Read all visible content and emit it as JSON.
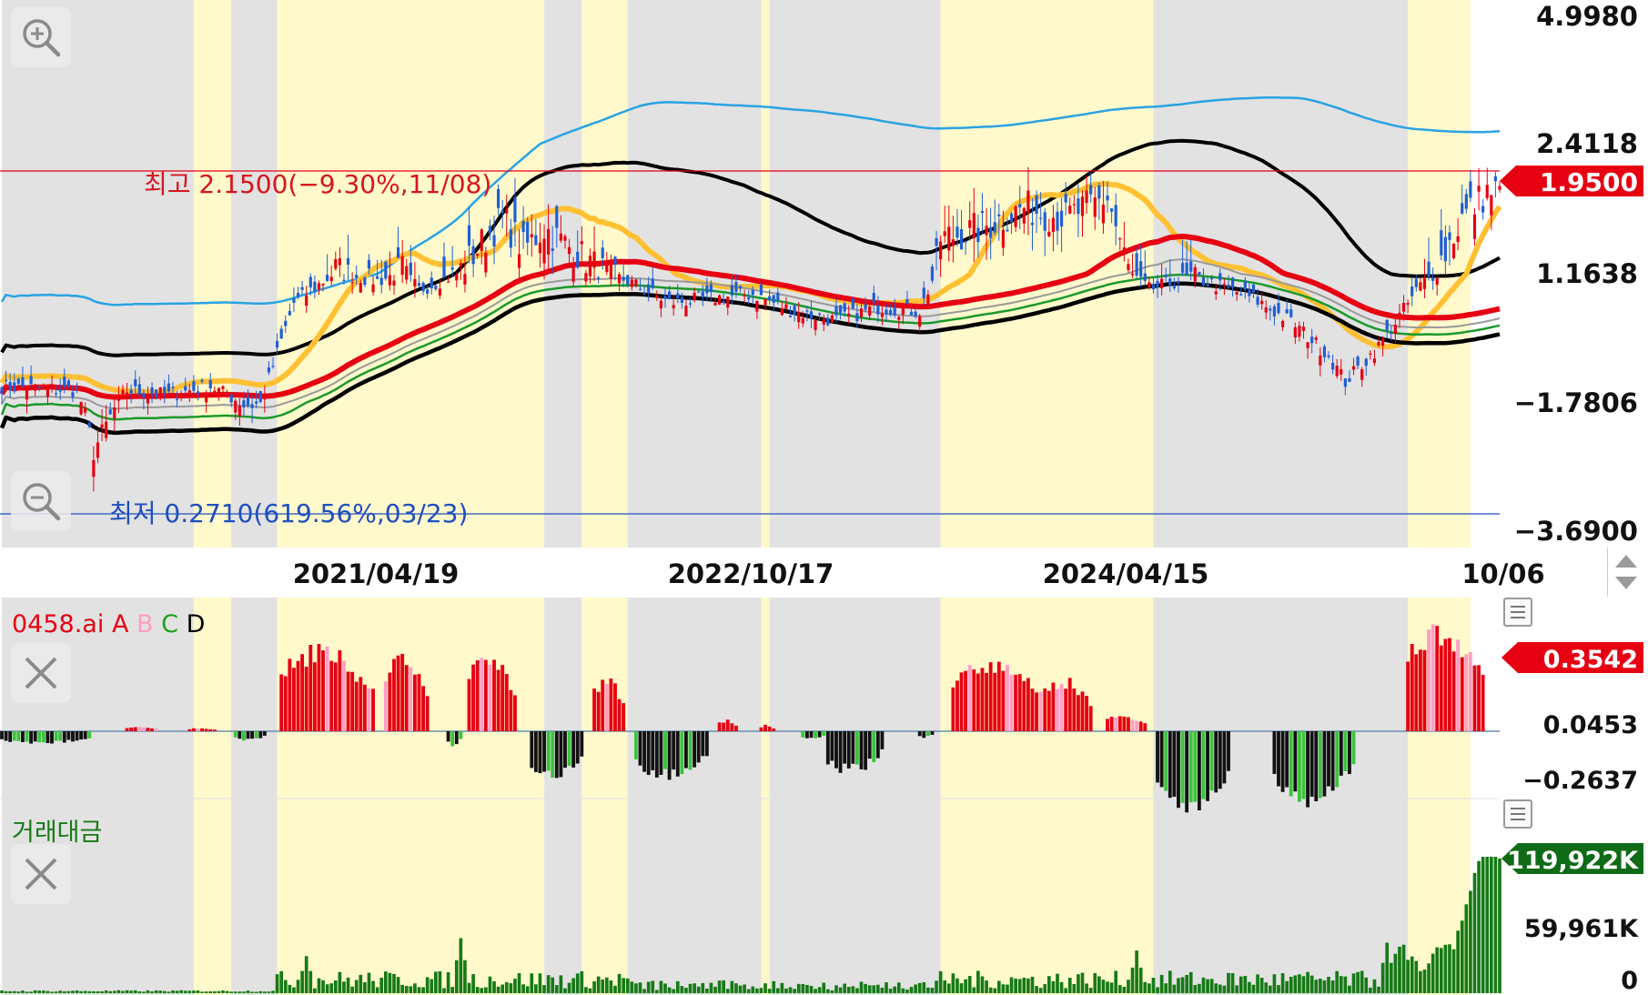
{
  "main": {
    "y_ticks": [
      "4.9980",
      "2.4118",
      "1.1638",
      "−1.7806",
      "−3.6900"
    ],
    "current_price": "1.9500",
    "high_label": "최고 2.1500(−9.30%,11/08)",
    "low_label": "최저 0.2710(619.56%,03/23)"
  },
  "x_axis": {
    "ticks": [
      "2021/04/19",
      "2022/10/17",
      "2024/04/15",
      "10/06"
    ]
  },
  "indicator": {
    "name": "0458.ai",
    "legend": [
      "A",
      "B",
      "C",
      "D"
    ],
    "legend_colors": [
      "#e60012",
      "#ff9ec7",
      "#1aa31a",
      "#000000"
    ],
    "y_ticks": [
      "0.0453",
      "−0.2637"
    ],
    "current_value": "0.3542"
  },
  "volume": {
    "title": "거래대금",
    "y_ticks": [
      "59,961K",
      "0"
    ],
    "current_value": "119,922K"
  },
  "colors": {
    "up": "#e60012",
    "down": "#1f5fd6",
    "band_outer": "#29a3e3",
    "envelope": "#000000",
    "ma_yellow": "#ffc133",
    "ma_red": "#e60012",
    "ma_green": "#1a9a2a",
    "ma_gray": "#9a9a9a",
    "shade_gray": "#e2e2e2",
    "shade_yellow": "#fff9cc",
    "volume": "#157a15"
  },
  "chart_data": [
    {
      "type": "candlestick",
      "title": "",
      "y_ticks": [
        4.998,
        2.4118,
        1.1638,
        -1.7806,
        -3.69
      ],
      "ylim": [
        -3.69,
        4.998
      ],
      "x_ticks": [
        "2021/04/19",
        "2022/10/17",
        "2024/04/15",
        "10/06"
      ],
      "last_close": 1.95,
      "high": {
        "value": 2.15,
        "pct": "−9.30%",
        "date": "11/08"
      },
      "low": {
        "value": 0.271,
        "pct": "619.56%",
        "date": "03/23"
      },
      "overlays": [
        "upper band (blue)",
        "envelope upper (black)",
        "MA (yellow)",
        "MA (red)",
        "MA (gray)",
        "MA (green)",
        "envelope lower (black)"
      ],
      "close_path": [
        [
          0,
          -1.4
        ],
        [
          18,
          -1.5
        ],
        [
          22,
          -2.5
        ],
        [
          30,
          -1.5
        ],
        [
          40,
          -1.6
        ],
        [
          50,
          -1.4
        ],
        [
          58,
          -1.8
        ],
        [
          62,
          -1.8
        ],
        [
          70,
          0.5
        ],
        [
          80,
          1.2
        ],
        [
          90,
          1.0
        ],
        [
          96,
          1.2
        ],
        [
          100,
          0.8
        ],
        [
          110,
          1.2
        ],
        [
          120,
          1.7
        ],
        [
          125,
          1.4
        ],
        [
          130,
          1.6
        ],
        [
          140,
          1.3
        ],
        [
          150,
          1.0
        ],
        [
          160,
          0.5
        ],
        [
          170,
          0.6
        ],
        [
          180,
          0.7
        ],
        [
          190,
          0.3
        ],
        [
          200,
          0.1
        ],
        [
          210,
          0.4
        ],
        [
          220,
          0.3
        ],
        [
          225,
          1.5
        ],
        [
          235,
          1.6
        ],
        [
          245,
          1.8
        ],
        [
          255,
          1.7
        ],
        [
          265,
          1.9
        ],
        [
          270,
          1.2
        ],
        [
          275,
          0.8
        ],
        [
          285,
          1.1
        ],
        [
          300,
          0.6
        ],
        [
          310,
          0.0
        ],
        [
          318,
          -0.7
        ],
        [
          322,
          -1.3
        ],
        [
          330,
          -0.5
        ],
        [
          340,
          0.9
        ],
        [
          350,
          1.7
        ],
        [
          356,
          1.95
        ]
      ],
      "volume_peaks_k": [
        {
          "x": 73,
          "v": 33000
        },
        {
          "x": 110,
          "v": 49000
        },
        {
          "x": 272,
          "v": 38000
        },
        {
          "x": 332,
          "v": 45000
        },
        {
          "x": 352,
          "v": 119922
        }
      ]
    },
    {
      "type": "bar",
      "title": "0458.ai",
      "series": [
        {
          "name": "A",
          "color": "#e60012"
        },
        {
          "name": "B",
          "color": "#ff9ec7"
        },
        {
          "name": "C",
          "color": "#1aa31a"
        },
        {
          "name": "D",
          "color": "#000000"
        }
      ],
      "y_ticks": [
        0.3542,
        0.0453,
        -0.2637
      ],
      "last_value": 0.3542,
      "segments": [
        [
          0,
          22,
          -0.08,
          "down"
        ],
        [
          30,
          38,
          0.03,
          "up"
        ],
        [
          45,
          52,
          0.02,
          "up"
        ],
        [
          56,
          64,
          -0.06,
          "down"
        ],
        [
          67,
          90,
          0.52,
          "up"
        ],
        [
          92,
          103,
          0.48,
          "up"
        ],
        [
          107,
          111,
          -0.1,
          "down"
        ],
        [
          112,
          124,
          0.47,
          "up"
        ],
        [
          127,
          140,
          -0.3,
          "down"
        ],
        [
          142,
          150,
          0.34,
          "up"
        ],
        [
          152,
          170,
          -0.29,
          "down"
        ],
        [
          172,
          177,
          0.07,
          "up"
        ],
        [
          182,
          186,
          0.04,
          "up"
        ],
        [
          192,
          198,
          -0.05,
          "down"
        ],
        [
          198,
          212,
          -0.26,
          "down"
        ],
        [
          220,
          224,
          -0.04,
          "down"
        ],
        [
          228,
          250,
          0.45,
          "up"
        ],
        [
          250,
          262,
          0.34,
          "up"
        ],
        [
          265,
          275,
          0.1,
          "up"
        ],
        [
          277,
          295,
          -0.5,
          "down"
        ],
        [
          305,
          325,
          -0.45,
          "down"
        ],
        [
          337,
          356,
          0.65,
          "up"
        ]
      ]
    },
    {
      "type": "bar",
      "title": "거래대금",
      "y_ticks": [
        119922,
        59961,
        0
      ],
      "unit": "K",
      "last_value": 119922
    }
  ]
}
